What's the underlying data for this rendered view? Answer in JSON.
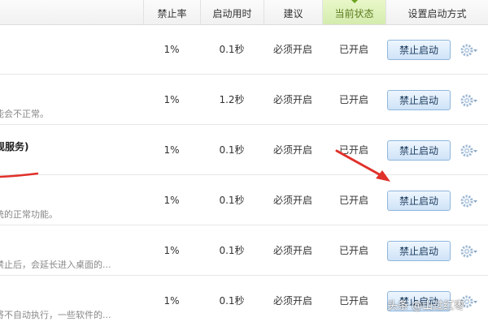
{
  "header": {
    "col_rate": "禁止率",
    "col_time": "启动用时",
    "col_advice": "建议",
    "col_status": "当前状态",
    "col_setting": "设置启动方式"
  },
  "rows": [
    {
      "name": "",
      "desc": "",
      "rate": "1%",
      "time": "0.1秒",
      "advice": "必须开启",
      "status": "已开启",
      "button": "禁止启动"
    },
    {
      "name": "",
      "desc": "能会不正常。",
      "rate": "1%",
      "time": "1.2秒",
      "advice": "必须开启",
      "status": "已开启",
      "button": "禁止启动"
    },
    {
      "name": "规服务)",
      "desc": "",
      "rate": "1%",
      "time": "0.1秒",
      "advice": "必须开启",
      "status": "已开启",
      "button": "禁止启动"
    },
    {
      "name": "",
      "desc": "统的正常功能。",
      "rate": "1%",
      "time": "0.1秒",
      "advice": "必须开启",
      "status": "已开启",
      "button": "禁止启动"
    },
    {
      "name": "",
      "desc": "禁止后，会延长进入桌面的...",
      "rate": "1%",
      "time": "0.1秒",
      "advice": "必须开启",
      "status": "已开启",
      "button": "禁止启动"
    },
    {
      "name": "",
      "desc": "将不自动执行，一些软件的...",
      "rate": "1%",
      "time": "0.1秒",
      "advice": "必须开启",
      "status": "已开启",
      "button": "禁止启动"
    }
  ],
  "watermark": "头条 @山过红枣",
  "colors": {
    "annotation_red": "#e0302a",
    "button_border": "#8fb6dc",
    "status_header": "#d4ecae"
  },
  "icons": {
    "settings": "gear-icon",
    "dropdown": "chevron-down-icon",
    "annotation": "red-arrow"
  }
}
